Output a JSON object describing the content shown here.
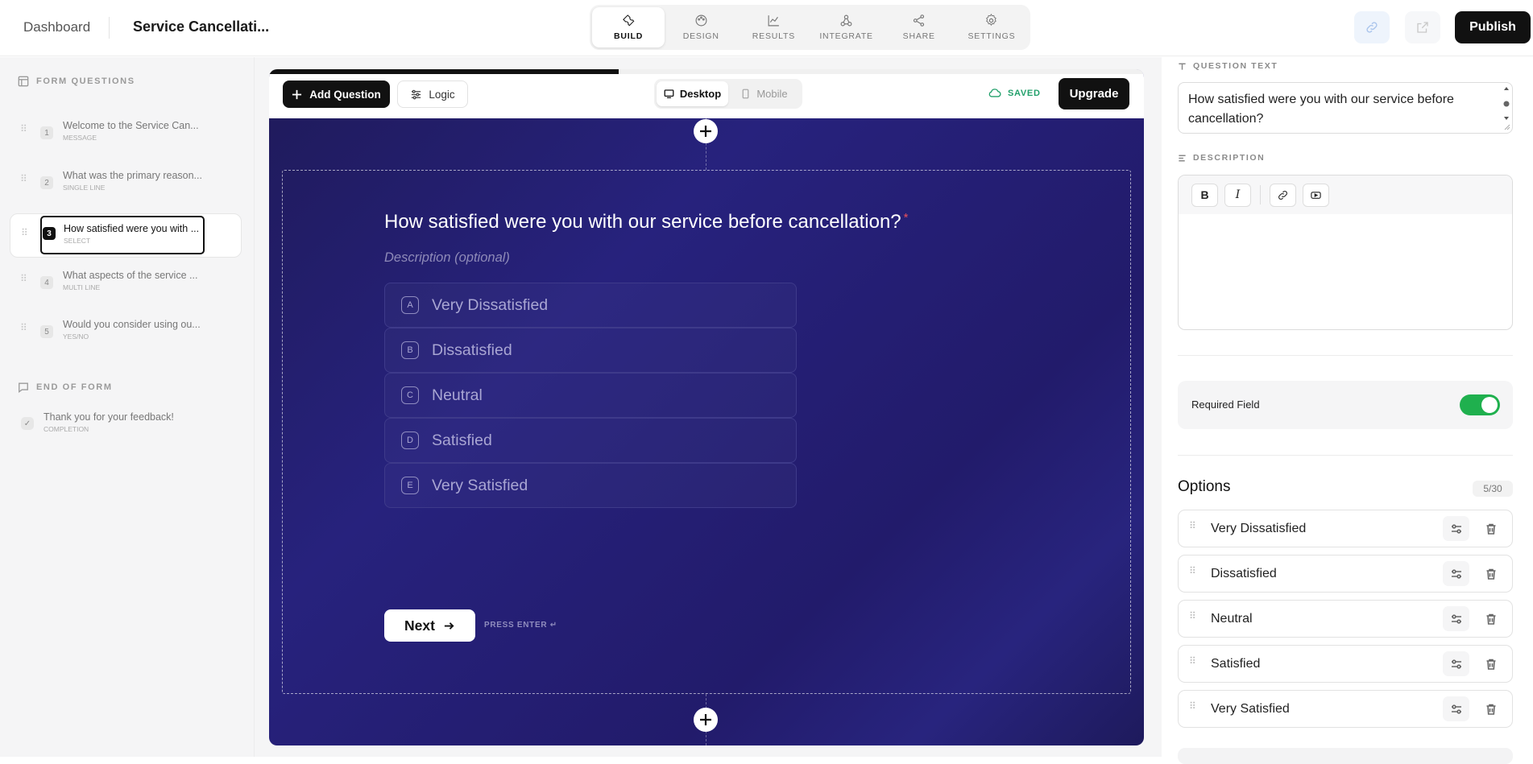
{
  "topbar": {
    "dashboard_label": "Dashboard",
    "form_title": "Service Cancellati...",
    "tabs": [
      {
        "label": "BUILD",
        "icon": "wrench-icon"
      },
      {
        "label": "DESIGN",
        "icon": "palette-icon"
      },
      {
        "label": "RESULTS",
        "icon": "chart-line-icon"
      },
      {
        "label": "INTEGRATE",
        "icon": "webhook-icon"
      },
      {
        "label": "SHARE",
        "icon": "share-icon"
      },
      {
        "label": "SETTINGS",
        "icon": "gear-icon"
      }
    ],
    "active_tab": "BUILD",
    "publish_label": "Publish"
  },
  "sidebar": {
    "questions_header": "FORM QUESTIONS",
    "questions": [
      {
        "number": "1",
        "label": "Welcome to the Service Can...",
        "type": "MESSAGE"
      },
      {
        "number": "2",
        "label": "What was the primary reason...",
        "type": "SINGLE LINE"
      },
      {
        "number": "3",
        "label": "How satisfied were you with ...",
        "type": "SELECT"
      },
      {
        "number": "4",
        "label": "What aspects of the service ...",
        "type": "MULTI LINE"
      },
      {
        "number": "5",
        "label": "Would you consider using ou...",
        "type": "YES/NO"
      }
    ],
    "end_header": "END OF FORM",
    "completion": {
      "label": "Thank you for your feedback!",
      "type": "COMPLETION"
    }
  },
  "canvas": {
    "progress": 0.4,
    "add_question_label": "Add Question",
    "logic_label": "Logic",
    "device_desktop": "Desktop",
    "device_mobile": "Mobile",
    "saved_label": "SAVED",
    "upgrade_label": "Upgrade",
    "question": {
      "title": "How satisfied were you with our service before cancellation?",
      "required_mark": "*",
      "description_placeholder": "Description (optional)",
      "options": [
        {
          "key": "A",
          "label": "Very Dissatisfied"
        },
        {
          "key": "B",
          "label": "Dissatisfied"
        },
        {
          "key": "C",
          "label": "Neutral"
        },
        {
          "key": "D",
          "label": "Satisfied"
        },
        {
          "key": "E",
          "label": "Very Satisfied"
        }
      ],
      "next_label": "Next",
      "press_enter": "PRESS ENTER ↵"
    },
    "background_color": "#27227d"
  },
  "right_panel": {
    "question_text_header": "QUESTION TEXT",
    "question_text": "How satisfied were you with our service before cancellation?",
    "description_header": "DESCRIPTION",
    "required_label": "Required Field",
    "required_on": true,
    "options_title": "Options",
    "options_count": "5/30",
    "options": [
      "Very Dissatisfied",
      "Dissatisfied",
      "Neutral",
      "Satisfied",
      "Very Satisfied"
    ],
    "toggle_color": "#1fb04e",
    "saved_color": "#22a06b"
  }
}
